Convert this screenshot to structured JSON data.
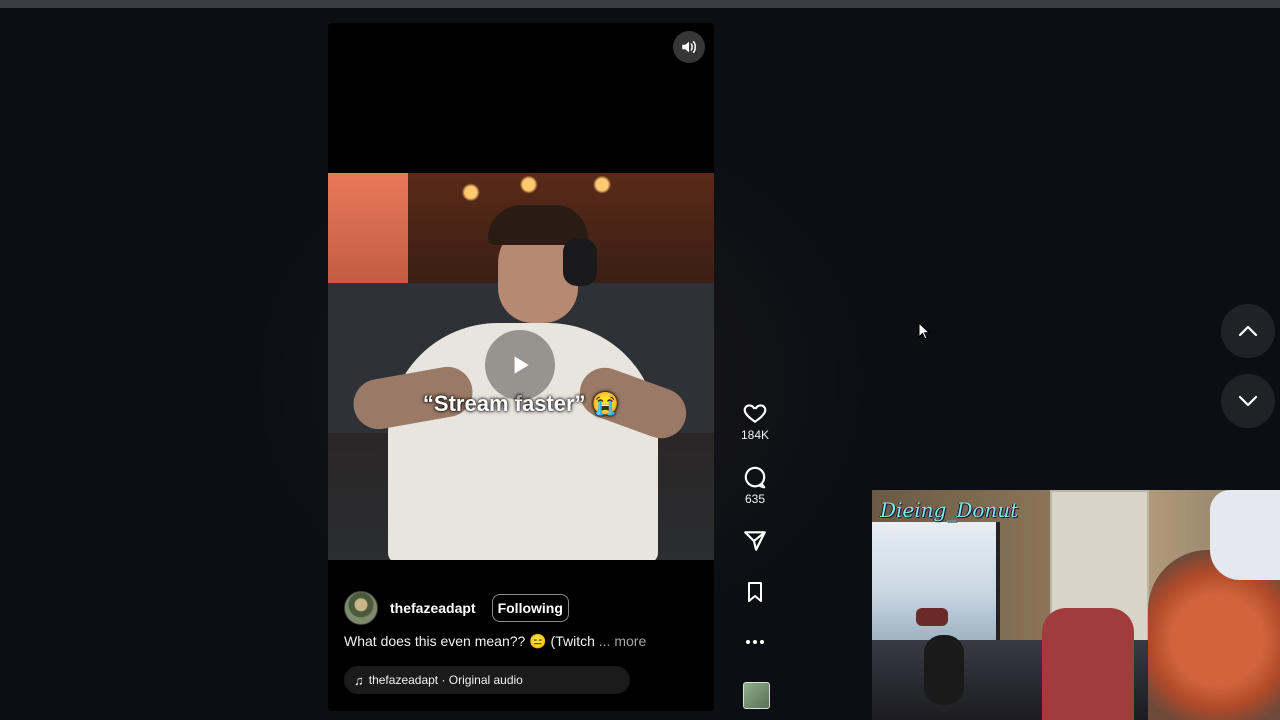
{
  "video": {
    "overlay_caption": "“Stream faster” 😭",
    "play_icon": "play-icon",
    "mute_icon": "speaker-icon"
  },
  "post": {
    "username": "thefazeadapt",
    "follow_label": "Following",
    "caption": "What does this even mean?? 😑 (Twitch",
    "more_label": "... more",
    "audio": "thefazeadapt · Original audio"
  },
  "actions": {
    "likes": "184K",
    "comments": "635"
  },
  "navigation": {
    "up_icon": "chevron-up-icon",
    "down_icon": "chevron-down-icon"
  },
  "webcam": {
    "label": "Dieing_Donut"
  },
  "colors": {
    "background": "#0b0f14",
    "reel_background": "#000000",
    "webcam_label": "#7ff0dc"
  }
}
